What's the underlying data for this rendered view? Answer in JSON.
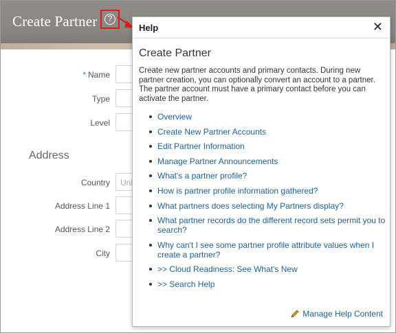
{
  "page": {
    "title": "Create Partner",
    "help_icon_glyph": "?"
  },
  "form": {
    "name_label": "Name",
    "required_marker": "*",
    "type_label": "Type",
    "level_label": "Level",
    "address_section": "Address",
    "country_label": "Country",
    "country_value": "Uni",
    "address1_label": "Address Line 1",
    "address2_label": "Address Line 2",
    "city_label": "City"
  },
  "help": {
    "title": "Help",
    "close_glyph": "✕",
    "topic_title": "Create Partner",
    "topic_desc": "Create new partner accounts and primary contacts. During new partner creation, you can optionally convert an account to a partner. The partner account must have a primary contact before you can activate the partner.",
    "links": [
      "Overview",
      "Create New Partner Accounts",
      "Edit Partner Information",
      "Manage Partner Announcements",
      "What's a partner profile?",
      "How is partner profile information gathered?",
      "What partners does selecting My Partners display?",
      "What partner records do the different record sets permit you to search?",
      "Why can't I see some partner profile attribute values when I create a partner?",
      ">> Cloud Readiness: See What's New",
      ">> Search Help"
    ],
    "manage_label": "Manage Help Content"
  },
  "colors": {
    "header": "#8f8c87",
    "highlight": "#e0191b",
    "link": "#1f5f94",
    "required": "#1e88d2"
  }
}
